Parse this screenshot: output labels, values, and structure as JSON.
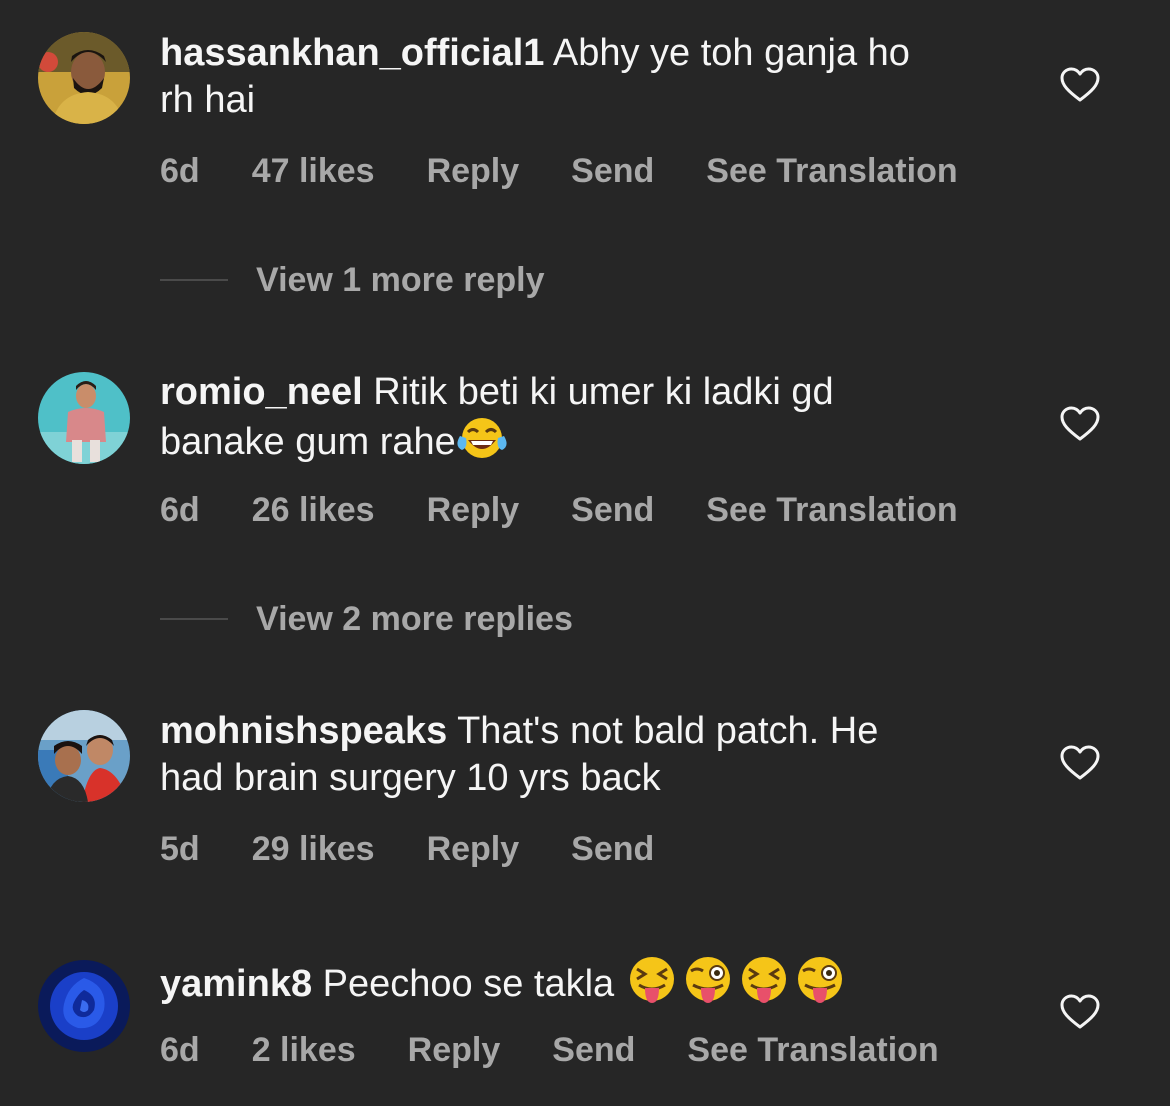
{
  "comments": [
    {
      "username": "hassankhan_official1",
      "text": "Abhy ye toh ganja ho\nrh hai",
      "time": "6d",
      "likes": "47 likes",
      "reply": "Reply",
      "send": "Send",
      "translate": "See Translation",
      "view_replies": "View 1 more reply"
    },
    {
      "username": "romio_neel",
      "text": "Ritik beti ki umer ki ladki gd\nbanake gum rahe",
      "time": "6d",
      "likes": "26 likes",
      "reply": "Reply",
      "send": "Send",
      "translate": "See Translation",
      "view_replies": "View 2 more replies"
    },
    {
      "username": "mohnishspeaks",
      "text": "That's not bald patch. He\nhad brain surgery 10 yrs back",
      "time": "5d",
      "likes": "29 likes",
      "reply": "Reply",
      "send": "Send"
    },
    {
      "username": "yamink8",
      "text": "Peechoo se takla",
      "time": "6d",
      "likes": "2 likes",
      "reply": "Reply",
      "send": "Send",
      "translate": "See Translation"
    }
  ],
  "icons": {
    "like": "heart-outline-icon",
    "laugh": "face-with-tears-of-joy-emoji",
    "tongue_closed": "squinting-face-with-tongue-emoji",
    "tongue_wink": "zany-face-emoji"
  },
  "colors": {
    "background": "#262626",
    "primary_text": "#f5f5f5",
    "secondary_text": "#a8a8a8"
  }
}
